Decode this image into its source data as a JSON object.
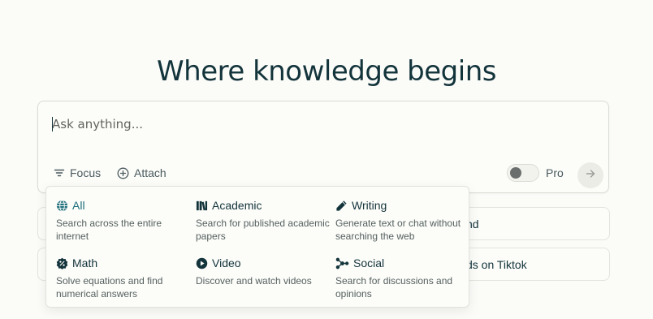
{
  "headline": "Where knowledge begins",
  "search": {
    "placeholder": "Ask anything...",
    "focus_label": "Focus",
    "attach_label": "Attach",
    "pro_label": "Pro",
    "pro_enabled": false
  },
  "suggestions": [
    {
      "label": "nd"
    },
    {
      "label": "ds on Tiktok"
    }
  ],
  "focus_menu": {
    "options": [
      {
        "title": "All",
        "description": "Search across the entire internet",
        "icon": "globe-icon",
        "selected": true
      },
      {
        "title": "Academic",
        "description": "Search for published academic papers",
        "icon": "books-icon",
        "selected": false
      },
      {
        "title": "Writing",
        "description": "Generate text or chat without searching the web",
        "icon": "pencil-icon",
        "selected": false
      },
      {
        "title": "Math",
        "description": "Solve equations and find numerical answers",
        "icon": "math-badge-icon",
        "selected": false
      },
      {
        "title": "Video",
        "description": "Discover and watch videos",
        "icon": "play-icon",
        "selected": false
      },
      {
        "title": "Social",
        "description": "Search for discussions and opinions",
        "icon": "social-network-icon",
        "selected": false
      }
    ]
  },
  "colors": {
    "background": "#fbfbf8",
    "text": "#13343b",
    "accent": "#1f6f7c"
  }
}
